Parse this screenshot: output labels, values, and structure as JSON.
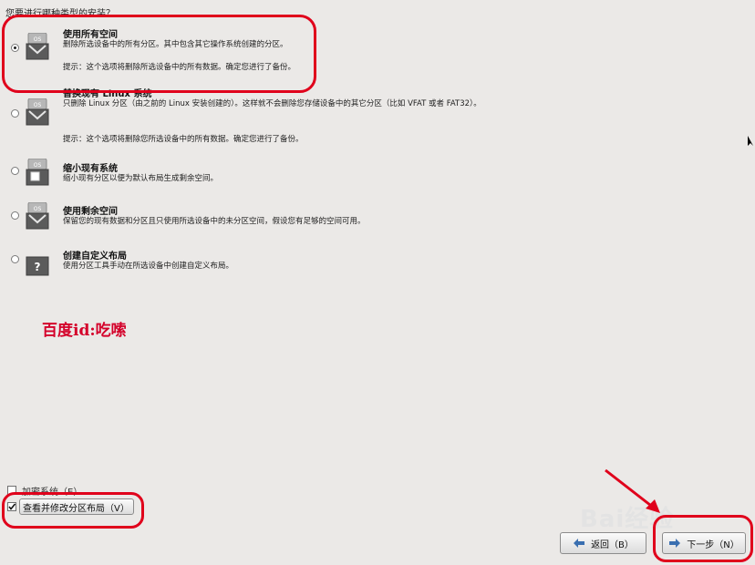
{
  "heading": "您要进行哪种类型的安装？",
  "options": [
    {
      "title": "使用所有空间",
      "desc": "删除所选设备中的所有分区。其中包含其它操作系统创建的分区。",
      "note": "提示：这个选项将删除所选设备中的所有数据。确定您进行了备份。",
      "selected": true,
      "icon": "os-disk-icon"
    },
    {
      "title": "替换现有 Linux 系统",
      "desc": "只删除 Linux 分区（由之前的 Linux 安装创建的）。这样就不会删除您存储设备中的其它分区（比如 VFAT 或者 FAT32）。",
      "note": "提示：这个选项将删除您所选设备中的所有数据。确定您进行了备份。",
      "selected": false,
      "icon": "os-disk-icon"
    },
    {
      "title": "缩小现有系统",
      "desc": "缩小现有分区以便为默认布局生成剩余空间。",
      "note": "",
      "selected": false,
      "icon": "shrink-disk-icon"
    },
    {
      "title": "使用剩余空间",
      "desc": "保留您的现有数据和分区且只使用所选设备中的未分区空间，假设您有足够的空间可用。",
      "note": "",
      "selected": false,
      "icon": "os-disk-icon"
    },
    {
      "title": "创建自定义布局",
      "desc": "使用分区工具手动在所选设备中创建自定义布局。",
      "note": "",
      "selected": false,
      "icon": "question-disk-icon"
    }
  ],
  "watermark": "百度id:吃嗦",
  "encrypt_label": "加密系统（E）",
  "encrypt_checked": false,
  "review_label": "查看并修改分区布局（V）",
  "review_checked": true,
  "back_label": "返回（B）",
  "next_label": "下一步（N）",
  "baidu_logo_text": "Bai经验",
  "annotation_color": "#e0001b"
}
